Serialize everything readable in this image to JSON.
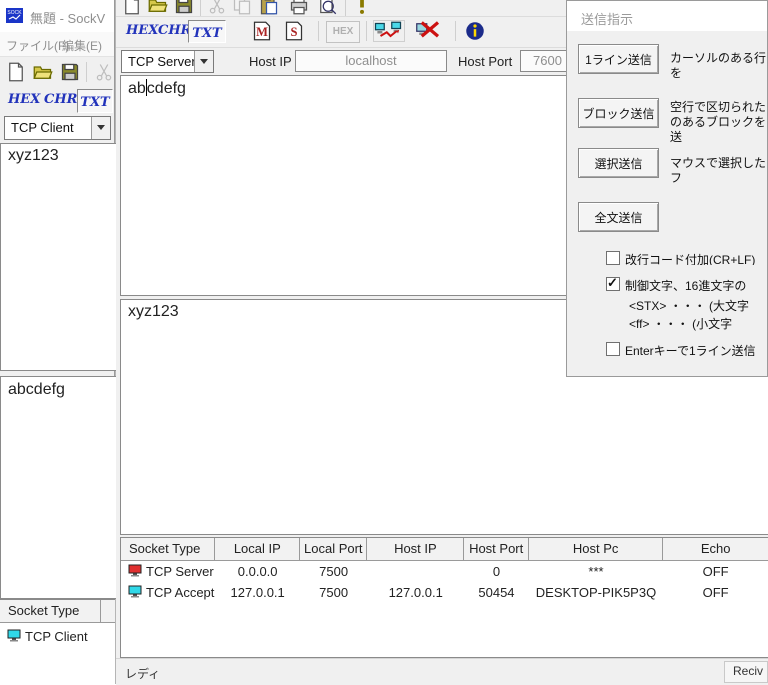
{
  "left_window": {
    "title": "無題 - SockV",
    "menu": {
      "file": "ファイル(F)",
      "edit": "編集(E)"
    },
    "tabs": {
      "hex": "HEX",
      "chr": "CHR",
      "txt": "TXT"
    },
    "socket_type": "TCP Client",
    "send_area_text": "xyz123",
    "recv_area_text": "abcdefg",
    "table": {
      "header": "Socket Type",
      "row_type": "TCP Client"
    }
  },
  "main_window": {
    "tabs": {
      "hex": "HEX",
      "chr": "CHR",
      "txt": "TXT"
    },
    "toolbar": {
      "m": "M",
      "s": "S",
      "hex": "HEX"
    },
    "socket_type": "TCP Server",
    "host_ip": {
      "label": "Host IP",
      "value": "localhost"
    },
    "host_port": {
      "label": "Host Port",
      "value": "7600"
    },
    "send_text_before_caret": "ab",
    "send_text_after_caret": "cdefg",
    "recv_text": "xyz123",
    "socket_table": {
      "columns": [
        "Socket Type",
        "Local IP",
        "Local Port",
        "Host IP",
        "Host Port",
        "Host Pc",
        "Echo"
      ],
      "rows": [
        {
          "type": "TCP Server",
          "local_ip": "0.0.0.0",
          "local_port": "7500",
          "host_ip": "",
          "host_port": "0",
          "host_pc": "***",
          "echo": "OFF",
          "icon_color": "#e03030"
        },
        {
          "type": "TCP Accept",
          "local_ip": "127.0.0.1",
          "local_port": "7500",
          "host_ip": "127.0.0.1",
          "host_port": "50454",
          "host_pc": "DESKTOP-PIK5P3Q",
          "echo": "OFF",
          "icon_color": "#30d8e8"
        }
      ]
    },
    "status": {
      "left": "レディ",
      "right": "Reciv"
    }
  },
  "send_dialog": {
    "title": "送信指示",
    "buttons": [
      {
        "label": "1ライン送信",
        "desc": "カーソルのある行を"
      },
      {
        "label": "ブロック送信",
        "desc": "空行で区切られた\nのあるブロックを送"
      },
      {
        "label": "選択送信",
        "desc": "マウスで選択したフ"
      },
      {
        "label": "全文送信",
        "desc": ""
      }
    ],
    "checkboxes": [
      {
        "label": "改行コード付加(CR+LF)",
        "checked": false
      },
      {
        "label": "制御文字、16進文字の",
        "checked": true
      },
      {
        "label": "Enterキーで1ライン送信",
        "checked": false
      }
    ],
    "hints": [
      "<STX>  ・・・  (大文字",
      "<ff>  ・・・  (小文字"
    ]
  },
  "colors": {
    "accent_blue": "#2233bb",
    "server_icon": "#e03030",
    "client_icon": "#30d8e8"
  }
}
